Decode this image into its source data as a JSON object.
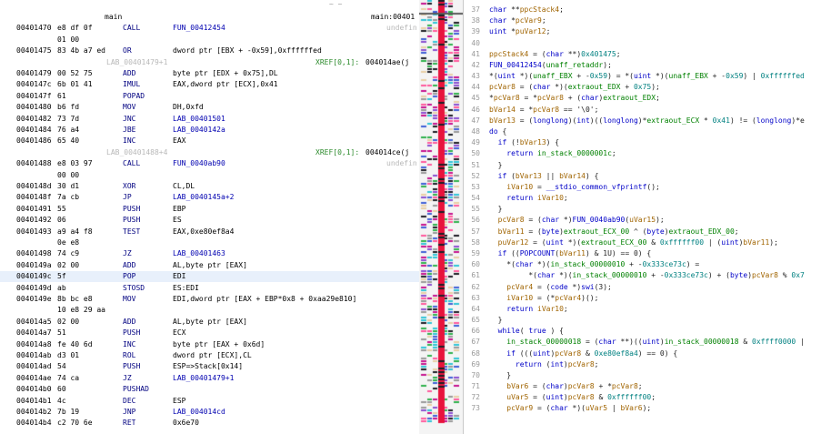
{
  "listing": {
    "header_tilde": "~      ~",
    "rows": [
      {
        "kind": "label",
        "label": "main",
        "xref": "",
        "xref_addr": "main:00401",
        "ghost": false
      },
      {
        "kind": "insn",
        "addr": "00401470",
        "bytes": "e8 df 0f",
        "mnemonic": "CALL",
        "operands": "FUN_00412454",
        "trail": "undefin"
      },
      {
        "kind": "cont",
        "bytes": "01 00"
      },
      {
        "kind": "insn",
        "addr": "00401475",
        "bytes": "83 4b a7 ed",
        "mnemonic": "OR",
        "operands": "dword ptr [EBX + -0x59],0xffffffed",
        "trail": ""
      },
      {
        "kind": "label",
        "label": "LAB_00401479+1",
        "xref": "XREF[0,1]:",
        "xref_addr": "004014ae(j",
        "ghost": true
      },
      {
        "kind": "insn",
        "addr": "00401479",
        "bytes": "00 52 75",
        "mnemonic": "ADD",
        "operands": "byte ptr [EDX + 0x75],DL",
        "trail": ""
      },
      {
        "kind": "insn",
        "addr": "0040147c",
        "bytes": "6b 01 41",
        "mnemonic": "IMUL",
        "operands": "EAX,dword ptr [ECX],0x41",
        "trail": ""
      },
      {
        "kind": "insn",
        "addr": "0040147f",
        "bytes": "61",
        "mnemonic": "POPAD",
        "operands": "",
        "trail": ""
      },
      {
        "kind": "insn",
        "addr": "00401480",
        "bytes": "b6 fd",
        "mnemonic": "MOV",
        "operands": "DH,0xfd",
        "trail": ""
      },
      {
        "kind": "insn",
        "addr": "00401482",
        "bytes": "73 7d",
        "mnemonic": "JNC",
        "operands": "LAB_00401501",
        "trail": ""
      },
      {
        "kind": "insn",
        "addr": "00401484",
        "bytes": "76 a4",
        "mnemonic": "JBE",
        "operands": "LAB_0040142a",
        "trail": ""
      },
      {
        "kind": "insn",
        "addr": "00401486",
        "bytes": "65 40",
        "mnemonic": "INC",
        "operands": "EAX",
        "trail": ""
      },
      {
        "kind": "label",
        "label": "LAB_00401488+4",
        "xref": "XREF[0,1]:",
        "xref_addr": "004014ce(j",
        "ghost": true
      },
      {
        "kind": "insn",
        "addr": "00401488",
        "bytes": "e8 03 97",
        "mnemonic": "CALL",
        "operands": "FUN_0040ab90",
        "trail": "undefin"
      },
      {
        "kind": "cont",
        "bytes": "00 00"
      },
      {
        "kind": "insn",
        "addr": "0040148d",
        "bytes": "30 d1",
        "mnemonic": "XOR",
        "operands": "CL,DL",
        "trail": ""
      },
      {
        "kind": "insn",
        "addr": "0040148f",
        "bytes": "7a cb",
        "mnemonic": "JP",
        "operands": "LAB_0040145a+2",
        "trail": ""
      },
      {
        "kind": "insn",
        "addr": "00401491",
        "bytes": "55",
        "mnemonic": "PUSH",
        "operands": "EBP",
        "trail": ""
      },
      {
        "kind": "insn",
        "addr": "00401492",
        "bytes": "06",
        "mnemonic": "PUSH",
        "operands": "ES",
        "trail": ""
      },
      {
        "kind": "insn",
        "addr": "00401493",
        "bytes": "a9 a4 f8",
        "mnemonic": "TEST",
        "operands": "EAX,0xe80ef8a4",
        "trail": ""
      },
      {
        "kind": "cont",
        "bytes": "0e e8"
      },
      {
        "kind": "insn",
        "addr": "00401498",
        "bytes": "74 c9",
        "mnemonic": "JZ",
        "operands": "LAB_00401463",
        "trail": ""
      },
      {
        "kind": "insn",
        "addr": "0040149a",
        "bytes": "02 00",
        "mnemonic": "ADD",
        "operands": "AL,byte ptr [EAX]",
        "trail": ""
      },
      {
        "kind": "insn",
        "addr": "0040149c",
        "bytes": "5f",
        "mnemonic": "POP",
        "operands": "EDI",
        "trail": "",
        "highlight": true
      },
      {
        "kind": "insn",
        "addr": "0040149d",
        "bytes": "ab",
        "mnemonic": "STOSD",
        "operands": "ES:EDI",
        "trail": ""
      },
      {
        "kind": "insn",
        "addr": "0040149e",
        "bytes": "8b bc e8",
        "mnemonic": "MOV",
        "operands": "EDI,dword ptr [EAX + EBP*0x8 + 0xaa29e810]",
        "trail": ""
      },
      {
        "kind": "cont",
        "bytes": "10 e8 29 aa"
      },
      {
        "kind": "insn",
        "addr": "004014a5",
        "bytes": "02 00",
        "mnemonic": "ADD",
        "operands": "AL,byte ptr [EAX]",
        "trail": ""
      },
      {
        "kind": "insn",
        "addr": "004014a7",
        "bytes": "51",
        "mnemonic": "PUSH",
        "operands": "ECX",
        "trail": ""
      },
      {
        "kind": "insn",
        "addr": "004014a8",
        "bytes": "fe 40 6d",
        "mnemonic": "INC",
        "operands": "byte ptr [EAX + 0x6d]",
        "trail": ""
      },
      {
        "kind": "insn",
        "addr": "004014ab",
        "bytes": "d3 01",
        "mnemonic": "ROL",
        "operands": "dword ptr [ECX],CL",
        "trail": ""
      },
      {
        "kind": "insn",
        "addr": "004014ad",
        "bytes": "54",
        "mnemonic": "PUSH",
        "operands": "ESP=>Stack[0x14]",
        "trail": ""
      },
      {
        "kind": "insn",
        "addr": "004014ae",
        "bytes": "74 ca",
        "mnemonic": "JZ",
        "operands": "LAB_00401479+1",
        "trail": ""
      },
      {
        "kind": "insn",
        "addr": "004014b0",
        "bytes": "60",
        "mnemonic": "PUSHAD",
        "operands": "",
        "trail": ""
      },
      {
        "kind": "insn",
        "addr": "004014b1",
        "bytes": "4c",
        "mnemonic": "DEC",
        "operands": "ESP",
        "trail": ""
      },
      {
        "kind": "insn",
        "addr": "004014b2",
        "bytes": "7b 19",
        "mnemonic": "JNP",
        "operands": "LAB_004014cd",
        "trail": ""
      },
      {
        "kind": "insn",
        "addr": "004014b4",
        "bytes": "c2 70 6e",
        "mnemonic": "RET",
        "operands": "0x6e70",
        "trail": ""
      }
    ]
  },
  "decompiler": {
    "lines": [
      {
        "n": "37",
        "code": "char **ppcStack4;"
      },
      {
        "n": "38",
        "code": "char *pcVar9;"
      },
      {
        "n": "39",
        "code": "uint *puVar12;"
      },
      {
        "n": "40",
        "code": ""
      },
      {
        "n": "41",
        "code": "ppcStack4 = (char **)0x401475;"
      },
      {
        "n": "42",
        "code": "FUN_00412454(unaff_retaddr);"
      },
      {
        "n": "43",
        "code": "*(uint *)(unaff_EBX + -0x59) = *(uint *)(unaff_EBX + -0x59) | 0xffffffed"
      },
      {
        "n": "44",
        "code": "pcVar8 = (char *)(extraout_EDX + 0x75);"
      },
      {
        "n": "45",
        "code": "*pcVar8 = *pcVar8 + (char)extraout_EDX;"
      },
      {
        "n": "46",
        "code": "bVar14 = *pcVar8 == '\\0';"
      },
      {
        "n": "47",
        "code": "bVar13 = (longlong)(int)((longlong)*extraout_ECX * 0x41) != (longlong)*e"
      },
      {
        "n": "48",
        "code": "do {"
      },
      {
        "n": "49",
        "code": "  if (!bVar13) {"
      },
      {
        "n": "50",
        "code": "    return in_stack_0000001c;"
      },
      {
        "n": "51",
        "code": "  }"
      },
      {
        "n": "52",
        "code": "  if (bVar13 || bVar14) {"
      },
      {
        "n": "53",
        "code": "    iVar10 = __stdio_common_vfprintf();"
      },
      {
        "n": "54",
        "code": "    return iVar10;"
      },
      {
        "n": "55",
        "code": "  }"
      },
      {
        "n": "56",
        "code": "  pcVar8 = (char *)FUN_0040ab90(uVar15);"
      },
      {
        "n": "57",
        "code": "  bVar11 = (byte)extraout_ECX_00 ^ (byte)extraout_EDX_00;"
      },
      {
        "n": "58",
        "code": "  puVar12 = (uint *)(extraout_ECX_00 & 0xffffff00 | (uint)bVar11);"
      },
      {
        "n": "59",
        "code": "  if ((POPCOUNT(bVar11) & 1U) == 0) {"
      },
      {
        "n": "60",
        "code": "    *(char *)(in_stack_00000010 + -0x333ce73c) ="
      },
      {
        "n": "61",
        "code": "         *(char *)(in_stack_00000010 + -0x333ce73c) + (byte)pcVar8 % 0x7"
      },
      {
        "n": "62",
        "code": "    pcVar4 = (code *)swi(3);"
      },
      {
        "n": "63",
        "code": "    iVar10 = (*pcVar4)();"
      },
      {
        "n": "64",
        "code": "    return iVar10;"
      },
      {
        "n": "65",
        "code": "  }"
      },
      {
        "n": "66",
        "code": "  while( true ) {"
      },
      {
        "n": "67",
        "code": "    in_stack_00000018 = (char **)((uint)in_stack_00000018 & 0xffff0000 |"
      },
      {
        "n": "68",
        "code": "    if (((uint)pcVar8 & 0xe80ef8a4) == 0) {"
      },
      {
        "n": "69",
        "code": "      return (int)pcVar8;"
      },
      {
        "n": "70",
        "code": "    }"
      },
      {
        "n": "71",
        "code": "    bVar6 = (char)pcVar8 + *pcVar8;"
      },
      {
        "n": "72",
        "code": "    uVar5 = (uint)pcVar8 & 0xffffff00;"
      },
      {
        "n": "73",
        "code": "    pcVar9 = (char *)(uVar5 | bVar6);"
      }
    ]
  },
  "overview_colors": {
    "red": "#e8133c",
    "pink": "#ff5b9e",
    "magenta": "#c6148f",
    "dark": "#1d1d25",
    "green": "#30b24e",
    "blue": "#3f5fd6",
    "cyan": "#31c4d6",
    "purple": "#8b4fd0",
    "gray": "#9a9a9a",
    "beige": "#e8cfa6"
  }
}
